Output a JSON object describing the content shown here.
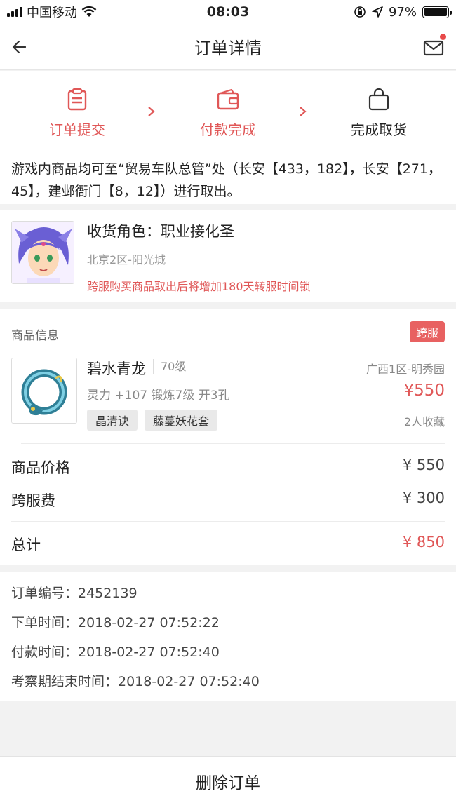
{
  "status_bar": {
    "carrier": "中国移动",
    "time": "08:03",
    "battery": "97%",
    "battery_level": 0.97
  },
  "nav": {
    "title": "订单详情",
    "has_unread": true
  },
  "steps": [
    {
      "label": "订单提交",
      "icon": "clipboard-icon",
      "state": "done"
    },
    {
      "label": "付款完成",
      "icon": "wallet-icon",
      "state": "done"
    },
    {
      "label": "完成取货",
      "icon": "shopping-bag-icon",
      "state": "todo"
    }
  ],
  "notice": "游戏内商品均可至“贸易车队总管”处（长安【433，182】，长安【271，45】，建邺衙门【8，12】）进行取出。",
  "receiver": {
    "name": "收货角色：职业接化圣",
    "server": "北京2区-阳光城",
    "warning": "跨服购买商品取出后将增加180天转服时间锁"
  },
  "goods": {
    "section_title": "商品信息",
    "badge": "跨服",
    "item": {
      "name": "碧水青龙",
      "level": "70级",
      "server": "广西1区-明秀园",
      "attributes": "灵力 +107 锻炼7级 开3孔",
      "price": "¥550",
      "tags": [
        "晶清诀",
        "藤蔓妖花套"
      ],
      "favorites": "2人收藏"
    },
    "fees": [
      {
        "label": "商品价格",
        "value": "¥ 550"
      },
      {
        "label": "跨服费",
        "value": "¥ 300"
      }
    ],
    "total": {
      "label": "总计",
      "value": "¥ 850"
    }
  },
  "order_info": [
    "订单编号：2452139",
    "下单时间：2018-02-27 07:52:22",
    "付款时间：2018-02-27 07:52:40",
    "考察期结束时间：2018-02-27 07:52:40"
  ],
  "action": {
    "delete_label": "删除订单"
  },
  "colors": {
    "accent": "#e05757",
    "badge": "#e86161",
    "background": "#f2f2f2"
  }
}
